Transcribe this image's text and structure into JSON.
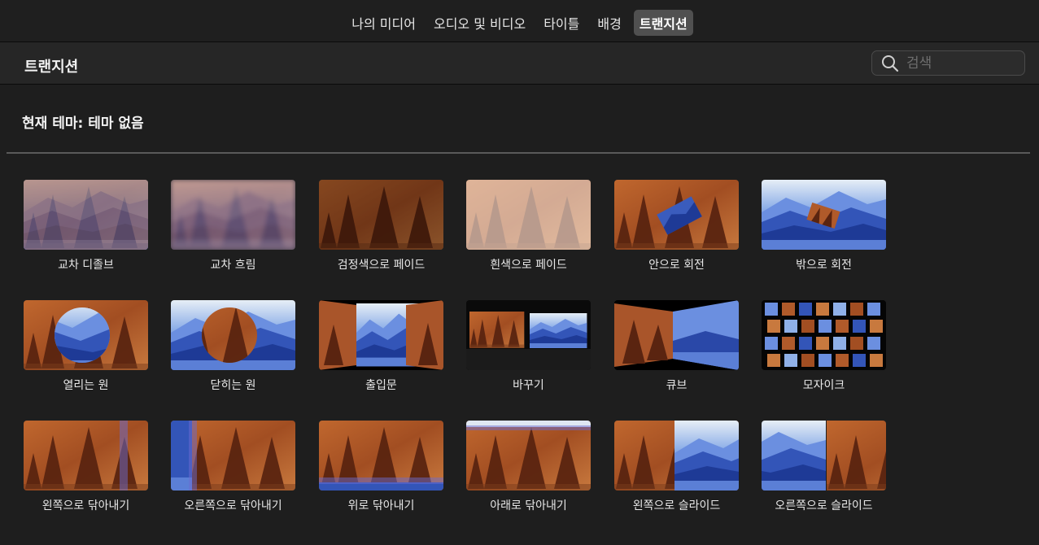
{
  "tabs": [
    {
      "label": "나의 미디어",
      "active": false
    },
    {
      "label": "오디오 및 비디오",
      "active": false
    },
    {
      "label": "타이틀",
      "active": false
    },
    {
      "label": "배경",
      "active": false
    },
    {
      "label": "트랜지션",
      "active": true
    }
  ],
  "header": {
    "title": "트랜지션"
  },
  "search": {
    "placeholder": "검색",
    "value": "",
    "icon": "magnifier-icon"
  },
  "theme": {
    "label": "현재 테마: 테마 없음"
  },
  "colors": {
    "wood": "#b05a2a",
    "mountain": "#3a5cbd",
    "active_tab": "#505050"
  },
  "transitions": [
    {
      "label": "교차 디졸브",
      "style": "crossdissolve"
    },
    {
      "label": "교차 흐림",
      "style": "crossblur"
    },
    {
      "label": "검정색으로 페이드",
      "style": "fadeblack"
    },
    {
      "label": "흰색으로 페이드",
      "style": "fadewhite"
    },
    {
      "label": "안으로 회전",
      "style": "spinin"
    },
    {
      "label": "밖으로 회전",
      "style": "spinout"
    },
    {
      "label": "열리는 원",
      "style": "circleopen"
    },
    {
      "label": "닫히는 원",
      "style": "circleclose"
    },
    {
      "label": "출입문",
      "style": "doorway"
    },
    {
      "label": "바꾸기",
      "style": "swap"
    },
    {
      "label": "큐브",
      "style": "cube"
    },
    {
      "label": "모자이크",
      "style": "mosaic"
    },
    {
      "label": "왼쪽으로 닦아내기",
      "style": "wipeleft"
    },
    {
      "label": "오른쪽으로 닦아내기",
      "style": "wiperight"
    },
    {
      "label": "위로 닦아내기",
      "style": "wipeup"
    },
    {
      "label": "아래로 닦아내기",
      "style": "wipedown"
    },
    {
      "label": "왼쪽으로 슬라이드",
      "style": "slideleft"
    },
    {
      "label": "오른쪽으로 슬라이드",
      "style": "slideright"
    }
  ]
}
